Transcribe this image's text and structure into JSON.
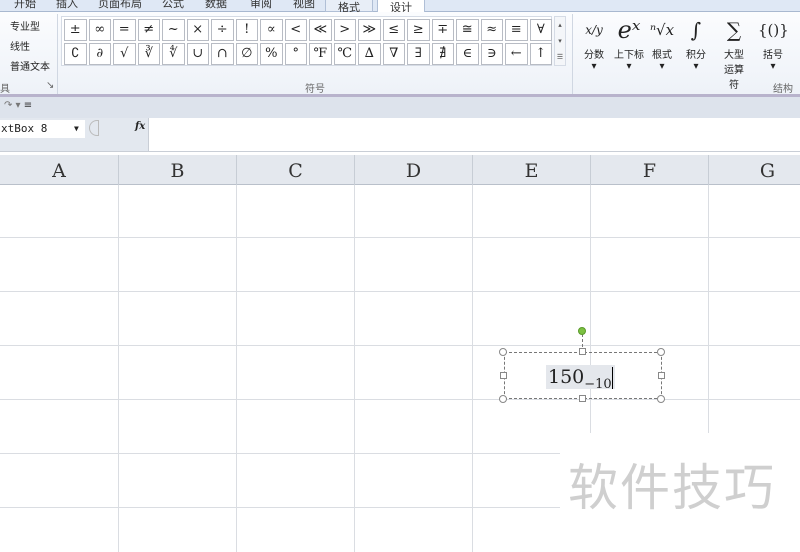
{
  "tabs": [
    "开始",
    "插入",
    "页面布局",
    "公式",
    "数据",
    "审阅",
    "视图",
    "格式",
    "设计"
  ],
  "tools": {
    "items": [
      "专业型",
      "线性",
      "普通文本"
    ],
    "group_label": "具"
  },
  "symbols": {
    "row1": [
      "±",
      "∞",
      "=",
      "≠",
      "~",
      "×",
      "÷",
      "!",
      "∝",
      "<",
      "≪",
      ">",
      "≫",
      "≤",
      "≥",
      "∓",
      "≅",
      "≈",
      "≡",
      "∀"
    ],
    "row2": [
      "∁",
      "∂",
      "√",
      "∛",
      "∜",
      "∪",
      "∩",
      "∅",
      "%",
      "°",
      "℉",
      "℃",
      "∆",
      "∇",
      "∃",
      "∄",
      "∈",
      "∋",
      "←",
      "↑"
    ],
    "group_label": "符号"
  },
  "structures": {
    "items": [
      {
        "glyph": "x/y",
        "label": "分数"
      },
      {
        "glyph": "eˣ",
        "label": "上下标"
      },
      {
        "glyph": "ⁿ√x",
        "label": "根式"
      },
      {
        "glyph": "∫",
        "label": "积分"
      },
      {
        "glyph": "∑",
        "label": "大型运算符"
      },
      {
        "glyph": "{()}",
        "label": "括号"
      }
    ],
    "group_label": "结构"
  },
  "namebox": "xtBox 8",
  "fx": "fx",
  "columns": [
    "A",
    "B",
    "C",
    "D",
    "E",
    "F",
    "G"
  ],
  "textbox": {
    "base": "150",
    "subscript": "−10"
  },
  "watermark": "软件技巧"
}
